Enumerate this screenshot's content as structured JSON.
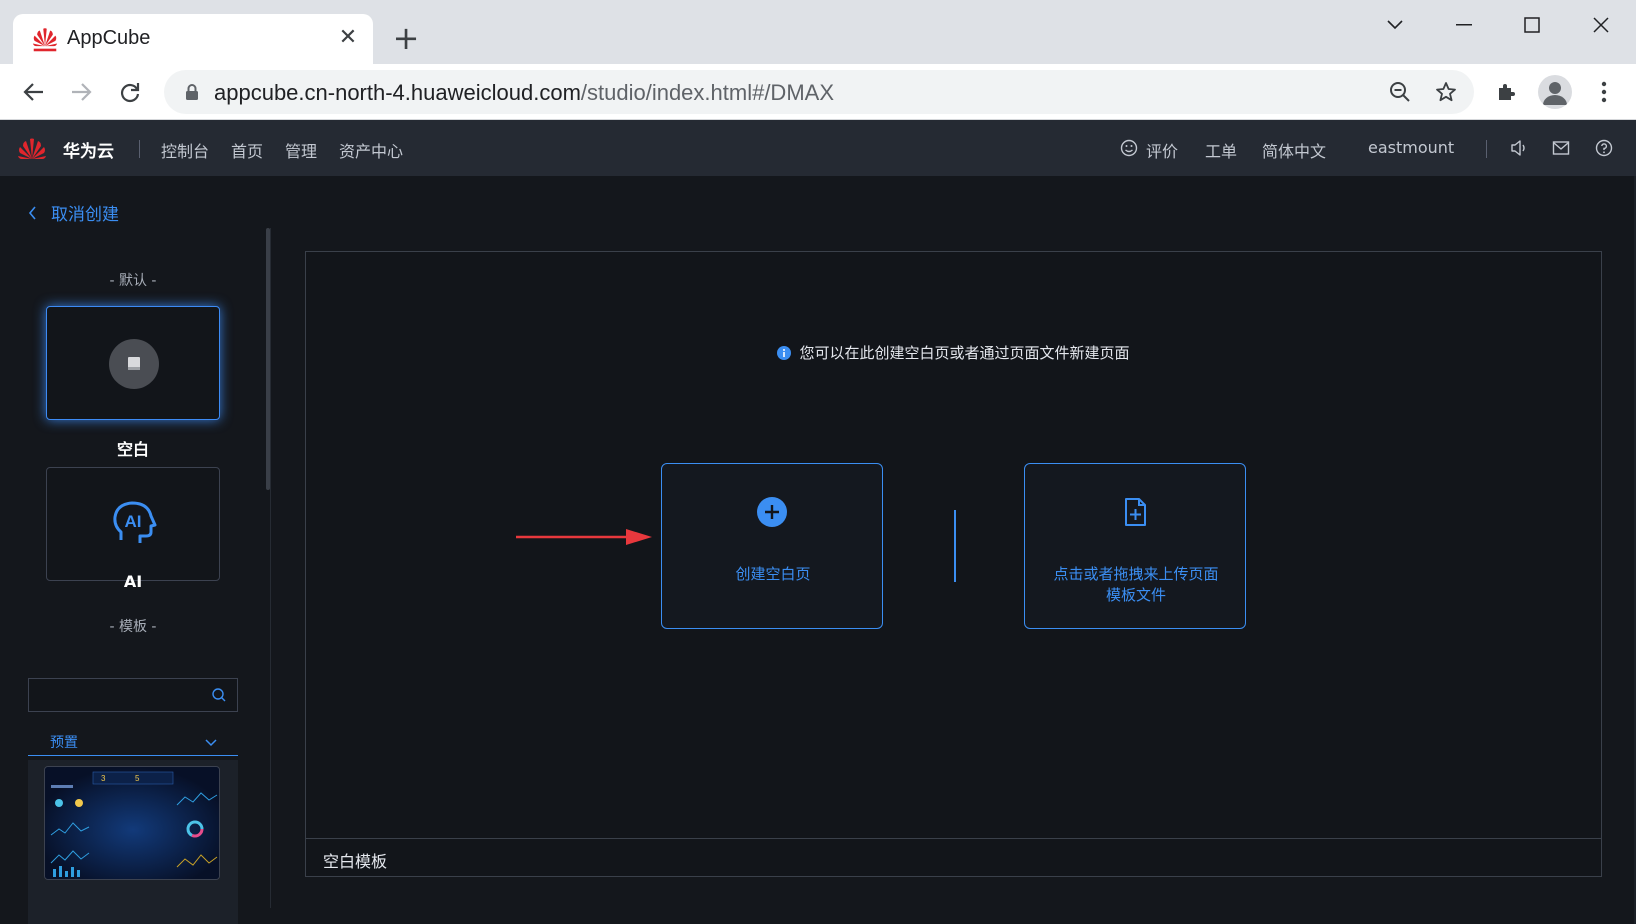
{
  "browser": {
    "tab_title": "AppCube",
    "url_host": "appcube.cn-north-4.huaweicloud.com",
    "url_path": "/studio/index.html#/DMAX"
  },
  "header": {
    "brand": "华为云",
    "nav": [
      "控制台",
      "首页",
      "管理",
      "资产中心"
    ],
    "right": {
      "rate": "评价",
      "ticket": "工单",
      "language": "简体中文",
      "username": "eastmount"
    }
  },
  "left_panel": {
    "cancel": "取消创建",
    "default_section": "- 默认 -",
    "cards": [
      {
        "label": "空白",
        "icon": "blank-page-icon",
        "selected": true
      },
      {
        "label": "AI",
        "icon": "ai-head-icon",
        "selected": false
      }
    ],
    "template_section": "- 模板 -",
    "search_placeholder": "",
    "category": "预置"
  },
  "main": {
    "tip": "您可以在此创建空白页或者通过页面文件新建页面",
    "create_blank": "创建空白页",
    "upload_line1": "点击或者拖拽来上传页面",
    "upload_line2": "模板文件",
    "footer": "空白模板"
  },
  "colors": {
    "accent": "#3b8ef2",
    "background": "#14171c",
    "header": "#252a33",
    "arrow": "#e8383d"
  }
}
